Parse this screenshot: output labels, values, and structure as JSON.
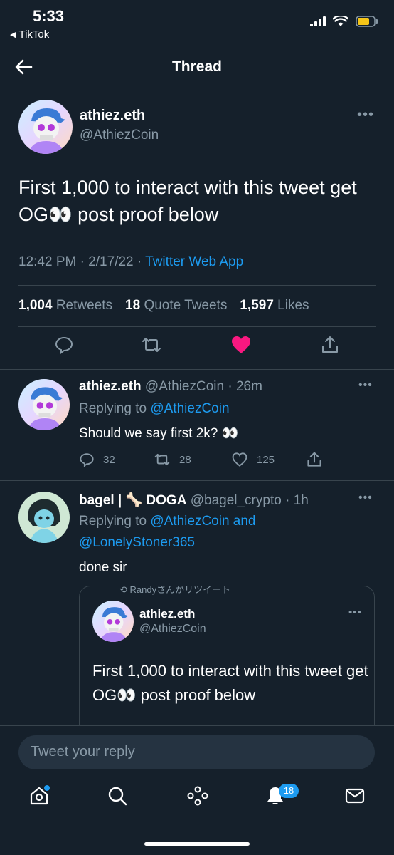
{
  "status_bar": {
    "time": "5:33",
    "back_app": "TikTok"
  },
  "header": {
    "title": "Thread"
  },
  "main_tweet": {
    "name": "athiez.eth",
    "handle": "@AthiezCoin",
    "text": "First 1,000 to interact with this tweet get OG👀 post proof below",
    "time": "12:42 PM · 2/17/22 · ",
    "source": "Twitter Web App",
    "retweets_count": "1,004",
    "retweets_label": "Retweets",
    "quotes_count": "18",
    "quotes_label": "Quote Tweets",
    "likes_count": "1,597",
    "likes_label": "Likes"
  },
  "replies": [
    {
      "name": "athiez.eth",
      "handle_time": "@AthiezCoin · 26m",
      "replying_prefix": "Replying to ",
      "replying_to": "@AthiezCoin",
      "text": "Should we say first 2k? 👀",
      "reply_count": "32",
      "retweet_count": "28",
      "like_count": "125"
    },
    {
      "name": "bagel | 🦴 DOGA",
      "handle_time": "@bagel_crypto · 1h",
      "replying_prefix": "Replying to ",
      "replying_to": "@AthiezCoin and",
      "replying_to_2": "@LonelyStoner365",
      "text": "done sir"
    }
  ],
  "quoted": {
    "retweet_note": "Randyさんがリツイート",
    "name": "athiez.eth",
    "handle": "@AthiezCoin",
    "text": "First 1,000 to interact with this tweet get OG👀 post proof below"
  },
  "composer": {
    "placeholder": "Tweet your reply"
  },
  "tabbar": {
    "notifications_badge": "18"
  },
  "colors": {
    "background": "#15202b",
    "accent": "#1d9bf0",
    "like": "#f91880",
    "muted": "#8899a6"
  }
}
